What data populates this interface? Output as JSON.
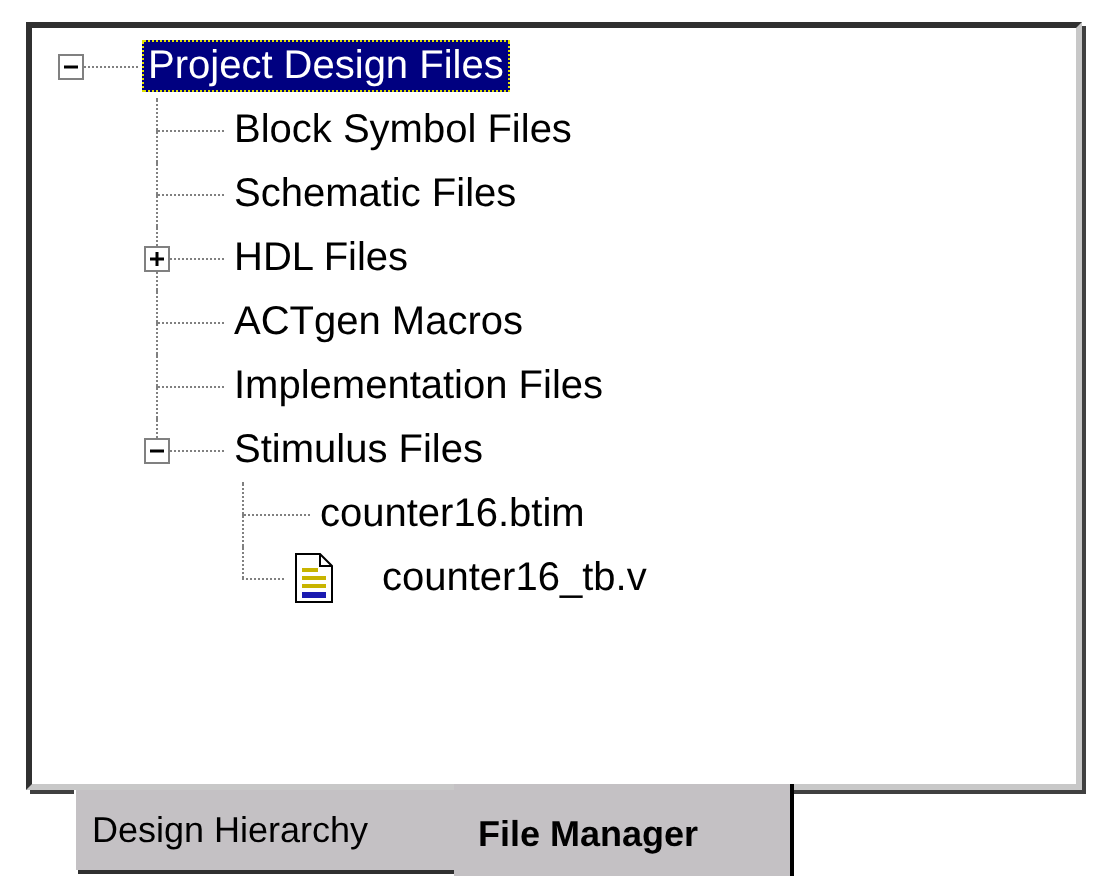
{
  "tree": [
    {
      "label": "Project Design Files",
      "selected": true,
      "expanded": true,
      "children": [
        {
          "label": "Block Symbol Files",
          "selected": false
        },
        {
          "label": "Schematic Files",
          "selected": false
        },
        {
          "label": "HDL Files",
          "selected": false,
          "expanded": false
        },
        {
          "label": "ACTgen Macros",
          "selected": false
        },
        {
          "label": "Implementation Files",
          "selected": false
        },
        {
          "label": "Stimulus Files",
          "selected": false,
          "expanded": true,
          "children": [
            {
              "label": "counter16.btim",
              "selected": false,
              "kind": "plain"
            },
            {
              "label": "counter16_tb.v",
              "selected": false,
              "kind": "hdl-file"
            }
          ]
        }
      ]
    }
  ],
  "tabs": [
    {
      "label": "Design Hierarchy",
      "selected": false
    },
    {
      "label": "File Manager",
      "selected": true
    }
  ]
}
